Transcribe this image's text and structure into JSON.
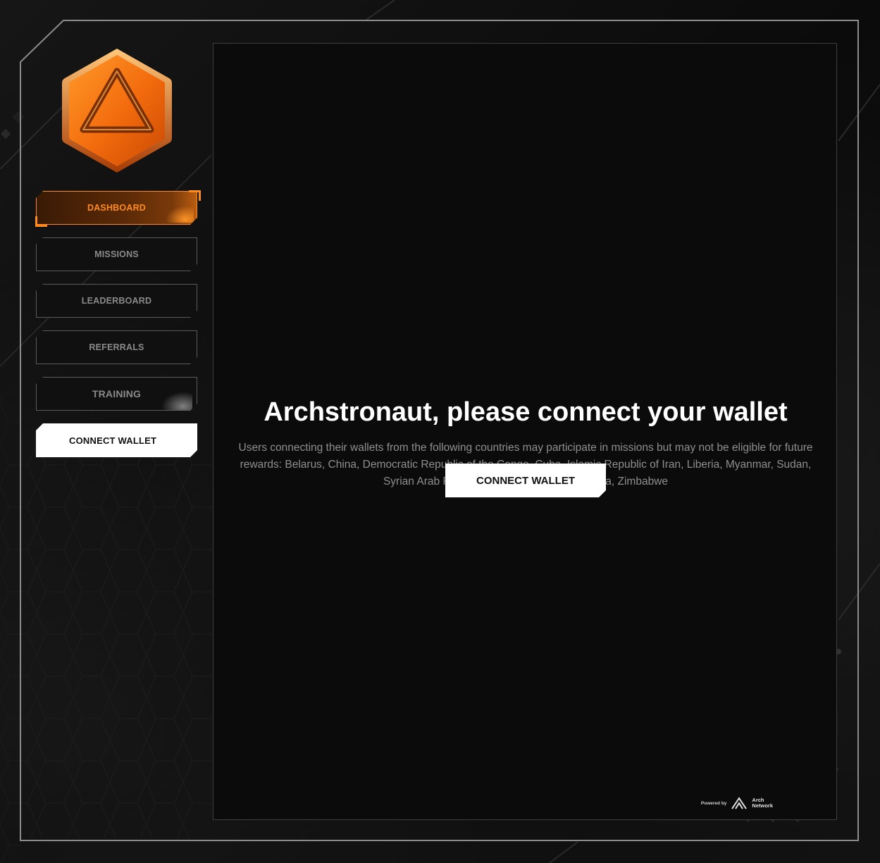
{
  "sidebar": {
    "logo_icon": "orange-hexagon-triangle-logo",
    "nav": {
      "dashboard": "DASHBOARD",
      "missions": "MISSIONS",
      "leaderboard": "LEADERBOARD",
      "referrals": "REFERRALS",
      "training": "TRAINING",
      "connect_wallet": "CONNECT WALLET"
    },
    "active_item": "DASHBOARD"
  },
  "main": {
    "headline": "Archstronaut, please connect your wallet",
    "notice": "Users connecting their wallets from the following countries may participate in missions but may not be eligible for future rewards: Belarus, China, Democratic Republic of the Congo, Cuba, Islamic Republic of Iran, Liberia, Myanmar, Sudan, Syrian Arab Republic, United States of America, Zimbabwe",
    "connect_button": "CONNECT WALLET"
  },
  "footer": {
    "powered_by": "Powered by",
    "brand_line1": "Arch",
    "brand_line2": "Network"
  },
  "colors": {
    "accent": "#ff8a1f",
    "background": "#0b0b0b",
    "button_light": "#ffffff",
    "muted_text": "#8f8f8f"
  }
}
